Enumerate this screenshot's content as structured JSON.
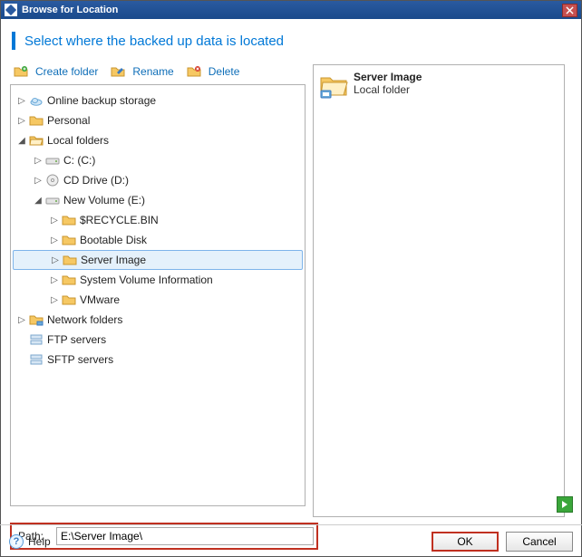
{
  "window": {
    "title": "Browse for Location"
  },
  "subtitle": "Select where the backed up data is located",
  "toolbar": {
    "create": "Create folder",
    "rename": "Rename",
    "delete": "Delete"
  },
  "tree": {
    "online_backup": "Online backup storage",
    "personal": "Personal",
    "local_folders": "Local folders",
    "c_drive": "C: (C:)",
    "cd_drive": "CD Drive (D:)",
    "new_volume": "New Volume (E:)",
    "recycle": "$RECYCLE.BIN",
    "bootable": "Bootable Disk",
    "server_image": "Server Image",
    "sysvol": "System Volume Information",
    "vmware": "VMware",
    "network_folders": "Network folders",
    "ftp": "FTP servers",
    "sftp": "SFTP servers"
  },
  "detail": {
    "title": "Server Image",
    "subtitle": "Local folder"
  },
  "path": {
    "label": "Path:",
    "value": "E:\\Server Image\\"
  },
  "footer": {
    "help": "Help",
    "ok": "OK",
    "cancel": "Cancel"
  }
}
